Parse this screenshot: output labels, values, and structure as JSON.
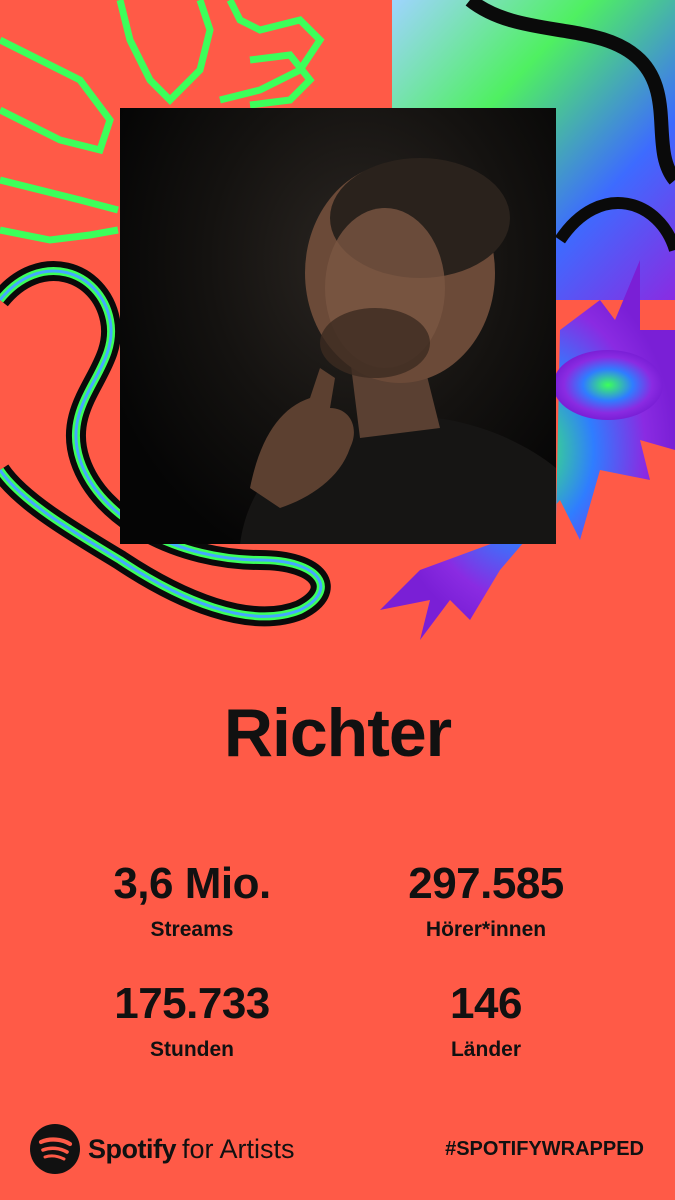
{
  "artist": {
    "name": "Richter"
  },
  "stats": [
    {
      "value": "3,6 Mio.",
      "label": "Streams"
    },
    {
      "value": "297.585",
      "label": "Hörer*innen"
    },
    {
      "value": "175.733",
      "label": "Stunden"
    },
    {
      "value": "146",
      "label": "Länder"
    }
  ],
  "footer": {
    "brand": "Spotify",
    "brand_suffix": "for Artists",
    "hashtag": "#SPOTIFYWRAPPED"
  },
  "icons": {
    "logo": "spotify-logo-icon"
  },
  "colors": {
    "background": "#ff5a47",
    "text": "#111111",
    "neon_green": "#3cff5a",
    "purple": "#8a2be2",
    "blue": "#3d6bff"
  }
}
